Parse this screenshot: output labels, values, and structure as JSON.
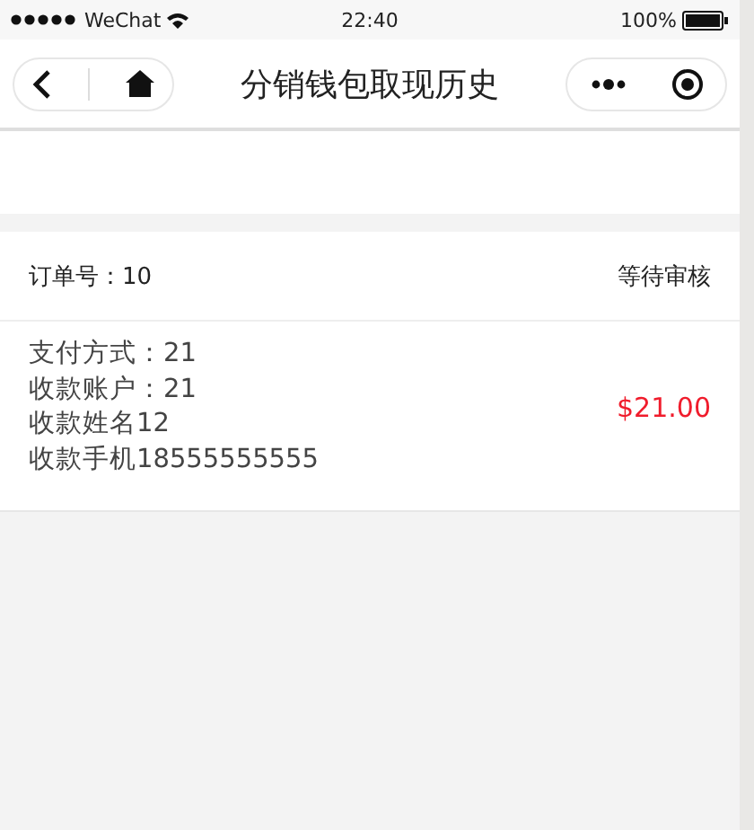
{
  "status_bar": {
    "carrier": "WeChat",
    "time": "22:40",
    "battery": "100%"
  },
  "nav": {
    "title": "分销钱包取现历史"
  },
  "records": [
    {
      "order_label": "订单号：10",
      "status": "等待审核",
      "lines": [
        "支付方式：21",
        "收款账户：21",
        "收款姓名12",
        "收款手机18555555555"
      ],
      "amount": "$21.00"
    }
  ]
}
